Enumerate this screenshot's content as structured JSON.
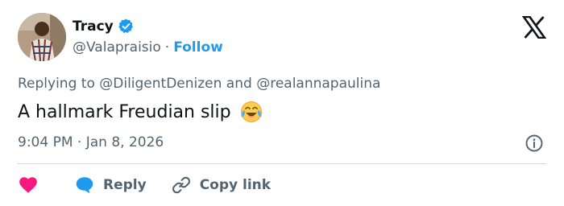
{
  "author": {
    "name": "Tracy",
    "handle": "@Valapraisio",
    "separator": "·",
    "follow_label": "Follow"
  },
  "reply_context": {
    "prefix": "Replying to ",
    "mention1": "@DiligentDenizen",
    "joiner": " and ",
    "mention2": "@realannapaulina"
  },
  "tweet": {
    "text": "A hallmark Freudian slip",
    "emoji": "face-with-tears-of-joy"
  },
  "timestamp": "9:04 PM · Jan 8, 2026",
  "actions": {
    "reply_label": "Reply",
    "copy_label": "Copy link"
  },
  "icons": {
    "verified": "verified-badge-icon",
    "x_logo": "x-logo-icon",
    "info": "info-icon",
    "like": "heart-icon",
    "reply": "speech-bubble-icon",
    "copy": "link-icon"
  },
  "colors": {
    "accent": "#1d9bf0",
    "text": "#0f1419",
    "muted": "#536471",
    "like": "#f91880"
  }
}
